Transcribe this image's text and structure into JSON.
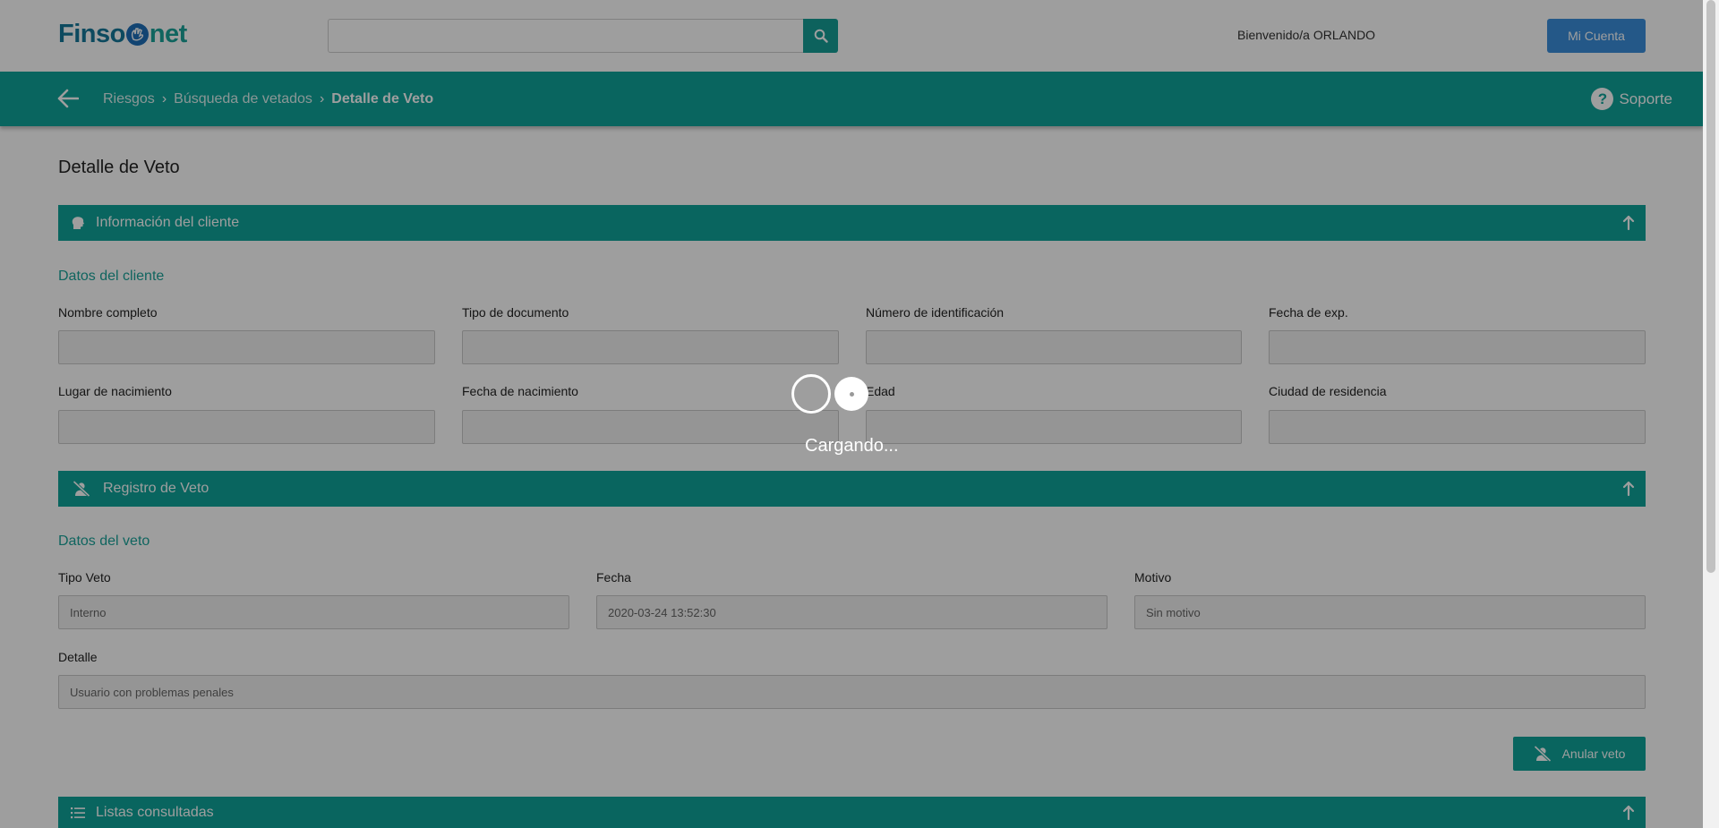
{
  "header": {
    "logo_left": "Finso",
    "logo_right": "net",
    "search_placeholder": "",
    "welcome": "Bienvenido/a ORLANDO",
    "account_button": "Mi Cuenta"
  },
  "nav": {
    "breadcrumbs": [
      "Riesgos",
      "Búsqueda de vetados",
      "Detalle de Veto"
    ],
    "support": "Soporte"
  },
  "page": {
    "title": "Detalle de Veto"
  },
  "client_section": {
    "title": "Información del cliente",
    "subtitle": "Datos del cliente",
    "fields": {
      "full_name": {
        "label": "Nombre completo",
        "value": ""
      },
      "doc_type": {
        "label": "Tipo de documento",
        "value": ""
      },
      "id_number": {
        "label": "Número de identificación",
        "value": ""
      },
      "exp_date": {
        "label": "Fecha de exp.",
        "value": ""
      },
      "birth_place": {
        "label": "Lugar de nacimiento",
        "value": ""
      },
      "birth_date": {
        "label": "Fecha de nacimiento",
        "value": ""
      },
      "age": {
        "label": "Edad",
        "value": ""
      },
      "residence_city": {
        "label": "Ciudad de residencia",
        "value": ""
      }
    }
  },
  "veto_section": {
    "title": "Registro de Veto",
    "subtitle": "Datos del veto",
    "fields": {
      "veto_type": {
        "label": "Tipo Veto",
        "value": "Interno"
      },
      "date": {
        "label": "Fecha",
        "value": "2020-03-24 13:52:30"
      },
      "reason": {
        "label": "Motivo",
        "value": "Sin motivo"
      },
      "detail": {
        "label": "Detalle",
        "value": "Usuario con problemas penales"
      }
    },
    "annul_button": "Anular veto"
  },
  "lists_section": {
    "title": "Listas consultadas"
  },
  "loading": {
    "text": "Cargando..."
  },
  "colors": {
    "primary": "#0fa39a",
    "accent_blue": "#3a8fdc",
    "overlay": "rgba(0,0,0,0.38)"
  }
}
